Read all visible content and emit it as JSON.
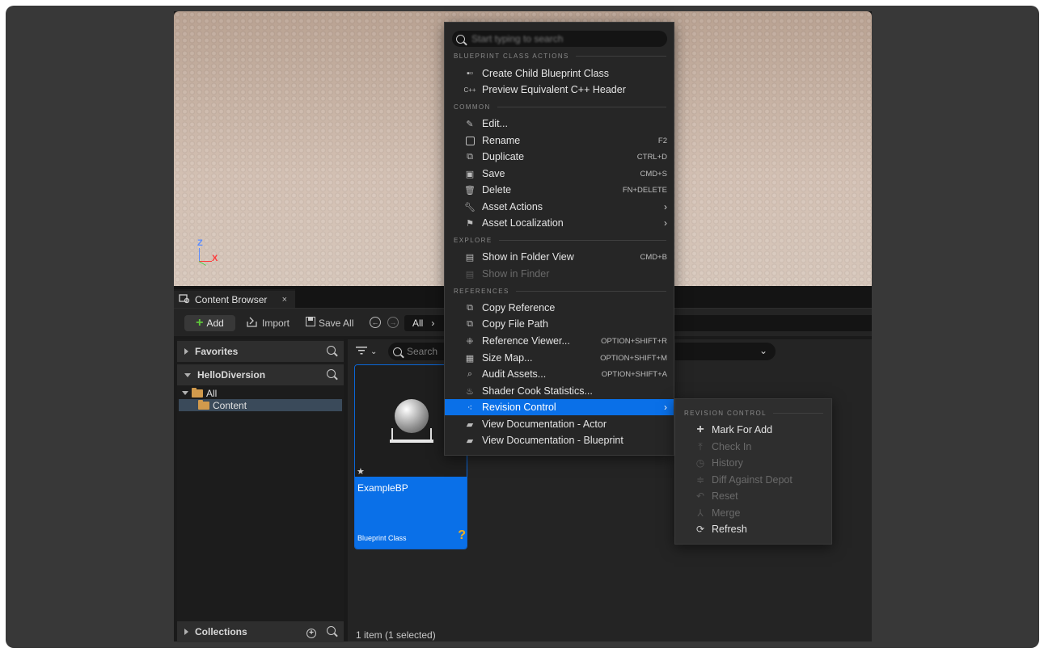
{
  "viewport": {
    "axis_z": "Z",
    "axis_x": "X"
  },
  "content_browser": {
    "tab_label": "Content Browser",
    "tab_close": "×",
    "toolbar": {
      "add_label": "Add",
      "import_label": "Import",
      "save_all_label": "Save All",
      "path_label": "All",
      "path_chevron": "›"
    },
    "left": {
      "favorites": "Favorites",
      "project": "HelloDiversion",
      "tree": [
        {
          "label": "All"
        },
        {
          "label": "Content"
        }
      ],
      "collections": "Collections"
    },
    "right": {
      "search_placeholder": "Search",
      "asset": {
        "name": "ExampleBP",
        "type": "Blueprint Class",
        "badge": "?"
      },
      "status": "1 item (1 selected)"
    }
  },
  "context_menu": {
    "search_placeholder": "Start typing to search",
    "sections": {
      "blueprint": "BLUEPRINT CLASS ACTIONS",
      "common": "COMMON",
      "explore": "EXPLORE",
      "references": "REFERENCES"
    },
    "items": [
      {
        "label": "Create Child Blueprint Class",
        "shortcut": ""
      },
      {
        "label": "Preview Equivalent C++ Header",
        "shortcut": ""
      },
      {
        "label": "Edit...",
        "shortcut": ""
      },
      {
        "label": "Rename",
        "shortcut": "F2"
      },
      {
        "label": "Duplicate",
        "shortcut": "CTRL+D"
      },
      {
        "label": "Save",
        "shortcut": "CMD+S"
      },
      {
        "label": "Delete",
        "shortcut": "FN+DELETE"
      },
      {
        "label": "Asset Actions",
        "shortcut": ""
      },
      {
        "label": "Asset Localization",
        "shortcut": ""
      },
      {
        "label": "Show in Folder View",
        "shortcut": "CMD+B"
      },
      {
        "label": "Show in Finder",
        "shortcut": ""
      },
      {
        "label": "Copy Reference",
        "shortcut": ""
      },
      {
        "label": "Copy File Path",
        "shortcut": ""
      },
      {
        "label": "Reference Viewer...",
        "shortcut": "OPTION+SHIFT+R"
      },
      {
        "label": "Size Map...",
        "shortcut": "OPTION+SHIFT+M"
      },
      {
        "label": "Audit Assets...",
        "shortcut": "OPTION+SHIFT+A"
      },
      {
        "label": "Shader Cook Statistics...",
        "shortcut": ""
      },
      {
        "label": "Revision Control",
        "shortcut": ""
      },
      {
        "label": "View Documentation - Actor",
        "shortcut": ""
      },
      {
        "label": "View Documentation - Blueprint",
        "shortcut": ""
      }
    ]
  },
  "revision_submenu": {
    "section": "REVISION CONTROL",
    "items": [
      {
        "label": "Mark For Add"
      },
      {
        "label": "Check In"
      },
      {
        "label": "History"
      },
      {
        "label": "Diff Against Depot"
      },
      {
        "label": "Reset"
      },
      {
        "label": "Merge"
      },
      {
        "label": "Refresh"
      }
    ]
  },
  "colors": {
    "accent": "#0a70e8",
    "add_plus": "#5fc93a",
    "folder": "#d19a4c",
    "badge": "#f2b01e"
  }
}
